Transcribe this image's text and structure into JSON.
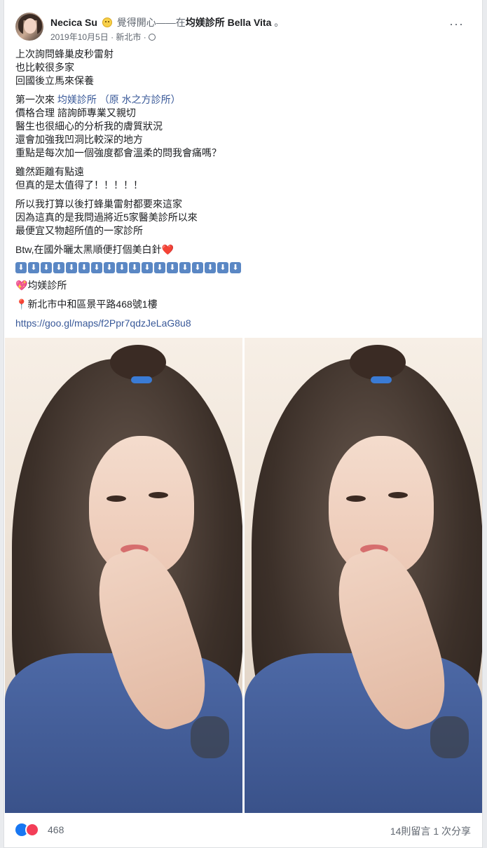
{
  "post": {
    "author": "Necica Su",
    "feeling": "覺得開心——在",
    "place": "均媄診所 Bella Vita",
    "dot": "。",
    "date": "2019年10月5日",
    "location": "新北市",
    "separator": "·",
    "more_label": "···"
  },
  "body": {
    "p1": [
      "上次詢問蜂巢皮秒雷射",
      "也比較很多家",
      "回國後立馬來保養"
    ],
    "p2_prefix": "第一次來 ",
    "p2_link": "均媄診所 （原 水之方診所）",
    "p2": [
      "價格合理 諮詢師專業又親切",
      "醫生也很細心的分析我的膚質狀況",
      "還會加強我凹洞比較深的地方",
      "重點是每次加一個強度都會溫柔的問我會痛嗎？"
    ],
    "p3": [
      "雖然距離有點遠",
      "但真的是太值得了！！！！！"
    ],
    "p4": [
      "所以我打算以後打蜂巢雷射都要來這家",
      "因為這真的是我問過將近5家醫美診所以來",
      "最便宜又物超所值的一家診所"
    ],
    "p5": "Btw,在國外曬太黑順便打個美白針",
    "p5_emoji": "❤️",
    "arrows": [
      "⬇",
      "⬇",
      "⬇",
      "⬇",
      "⬇",
      "⬇",
      "⬇",
      "⬇",
      "⬇",
      "⬇",
      "⬇",
      "⬇",
      "⬇",
      "⬇",
      "⬇",
      "⬇",
      "⬇",
      "⬇"
    ],
    "clinic_emoji": "💖",
    "clinic": "均媄診所",
    "address_emoji": "📍",
    "address": "新北市中和區景平路468號1樓",
    "url": "https://goo.gl/maps/f2Ppr7qdzJeLaG8u8"
  },
  "footer": {
    "reaction_count": "468",
    "comments": "14則留言",
    "shares": "1 次分享"
  },
  "colors": {
    "link": "#385898",
    "like": "#1877f2",
    "love": "#f33e58"
  }
}
